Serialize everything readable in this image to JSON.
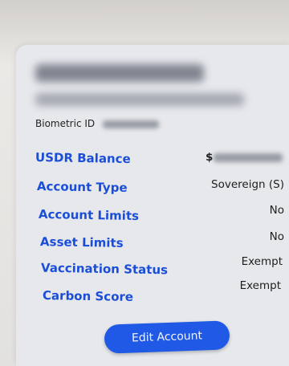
{
  "account": {
    "biometric_label": "Biometric ID",
    "rows": [
      {
        "label": "USDR Balance",
        "value": "$"
      },
      {
        "label": "Account Type",
        "value": "Sovereign (S)"
      },
      {
        "label": "Account Limits",
        "value": "No"
      },
      {
        "label": "Asset Limits",
        "value": "No"
      },
      {
        "label": "Vaccination Status",
        "value": "Exempt"
      },
      {
        "label": "Carbon Score",
        "value": "Exempt"
      }
    ],
    "edit_button": "Edit Account"
  }
}
